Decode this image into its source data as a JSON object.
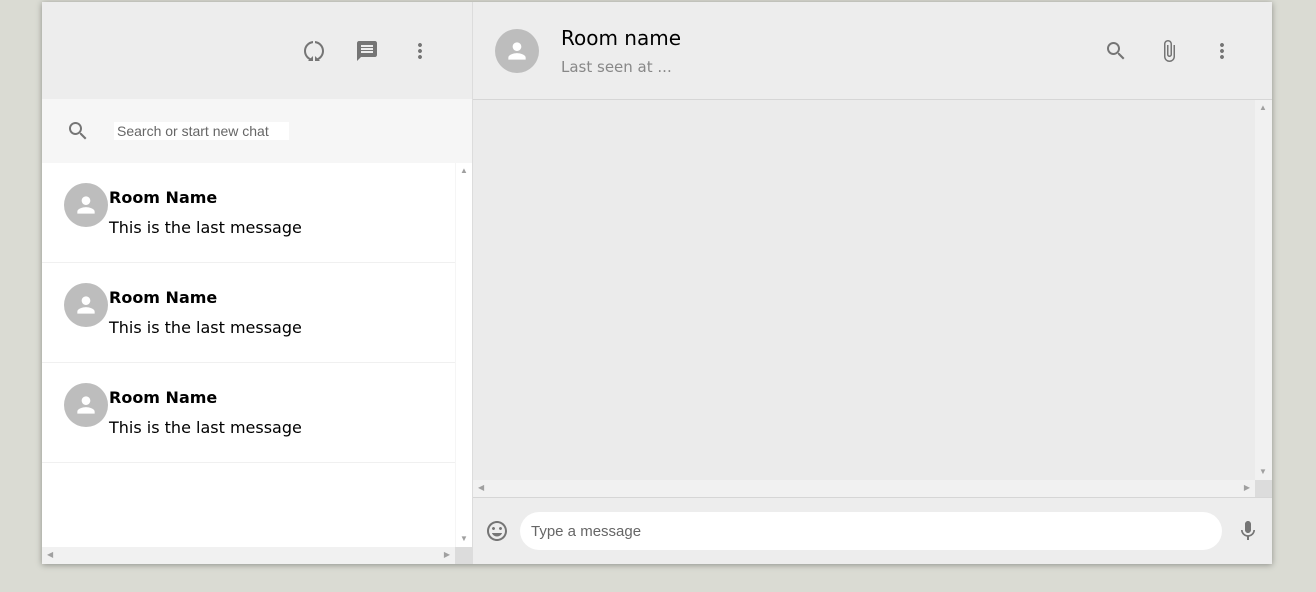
{
  "sidebar": {
    "header_icons": [
      "status-icon",
      "new-chat-icon",
      "more-vert-icon"
    ],
    "search": {
      "placeholder": "Search or start new chat",
      "value": ""
    },
    "chats": [
      {
        "name": "Room Name",
        "last_message": "This is the last message"
      },
      {
        "name": "Room Name",
        "last_message": "This is the last message"
      },
      {
        "name": "Room Name",
        "last_message": "This is the last message"
      }
    ]
  },
  "chat": {
    "header": {
      "title": "Room name",
      "subtitle": "Last seen at ..."
    },
    "header_icons": [
      "search-icon",
      "attach-icon",
      "more-vert-icon"
    ],
    "composer": {
      "placeholder": "Type a message",
      "value": ""
    },
    "footer_icons": [
      "emoji-icon",
      "mic-icon"
    ]
  },
  "colors": {
    "page_bg": "#dadbd3",
    "panel_bg": "#ededed",
    "avatar": "#bdbdbd",
    "icon": "#757575"
  }
}
